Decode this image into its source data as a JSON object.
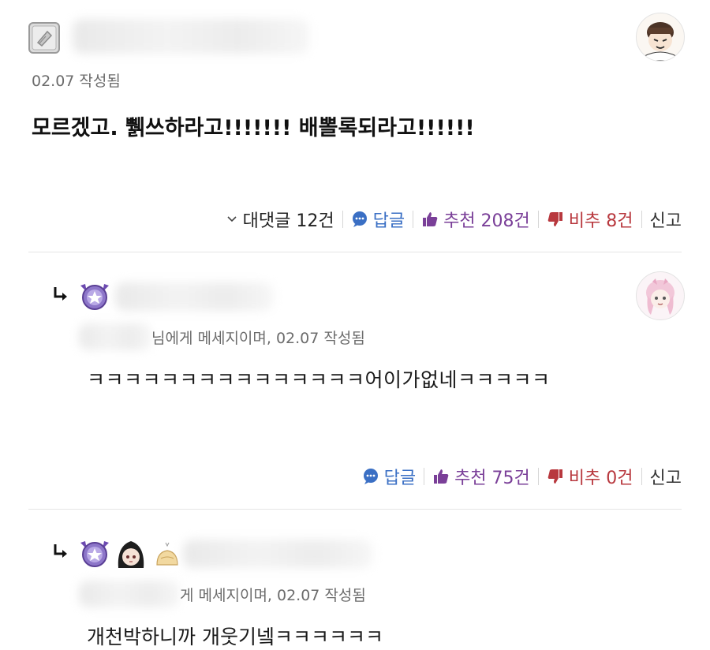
{
  "comment": {
    "date_meta": "02.07 작성됨",
    "text": "모르겠고. 쀍쓰하라고!!!!!!! 배뽈록되라고!!!!!!",
    "actions": {
      "replies_label": "대댓글 12건",
      "reply_label": "답글",
      "like_label": "추천 208건",
      "dislike_label": "비추 8건",
      "report_label": "신고"
    }
  },
  "reply1": {
    "meta": "님에게 메세지이며, 02.07 작성됨",
    "text": "ㅋㅋㅋㅋㅋㅋㅋㅋㅋㅋㅋㅋㅋㅋㅋ어이가없네ㅋㅋㅋㅋㅋ",
    "actions": {
      "reply_label": "답글",
      "like_label": "추천 75건",
      "dislike_label": "비추 0건",
      "report_label": "신고"
    }
  },
  "reply2": {
    "meta": "게 메세지이며, 02.07 작성됨",
    "text": "개천박하니까 개웃기넼ㅋㅋㅋㅋㅋㅋ"
  },
  "colors": {
    "blue": "#3a6fc4",
    "purple": "#7a3f98",
    "red": "#b8383e",
    "meta_grey": "#6c6c6c"
  },
  "icons": {
    "level_badge": "paper-scroll-icon",
    "reply_arrow": "reply-arrow-icon",
    "guild_badge": "purple-wing-star-icon",
    "comment": "speech-bubble-icon",
    "like": "thumbs-up-icon",
    "dislike": "thumbs-down-icon",
    "expand": "chevron-down-icon"
  }
}
